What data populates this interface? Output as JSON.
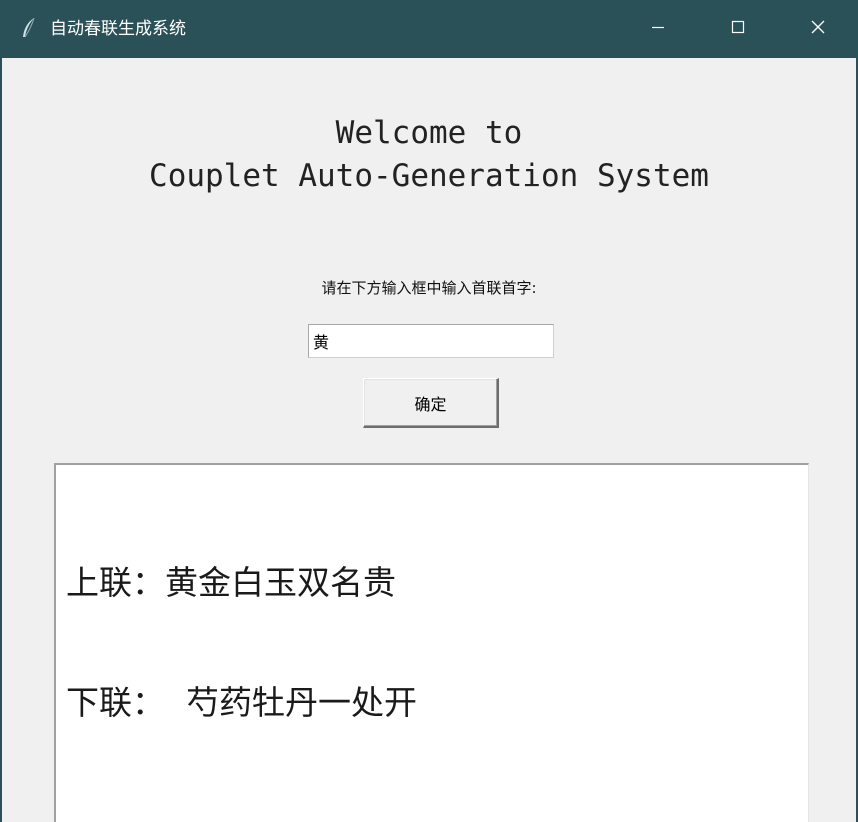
{
  "window": {
    "title": "自动春联生成系统",
    "titlebar_color": "#2b5158",
    "controls": {
      "minimize_icon": "minimize-icon",
      "maximize_icon": "maximize-icon",
      "close_icon": "close-icon"
    }
  },
  "welcome": {
    "line1": "Welcome to",
    "line2": "Couplet Auto-Generation System"
  },
  "form": {
    "prompt": "请在下方输入框中输入首联首字:",
    "input_value": "黄",
    "confirm_label": "确定"
  },
  "output": {
    "upper": "上联：黄金白玉双名贵",
    "lower": "下联：  芍药牡丹一处开"
  }
}
